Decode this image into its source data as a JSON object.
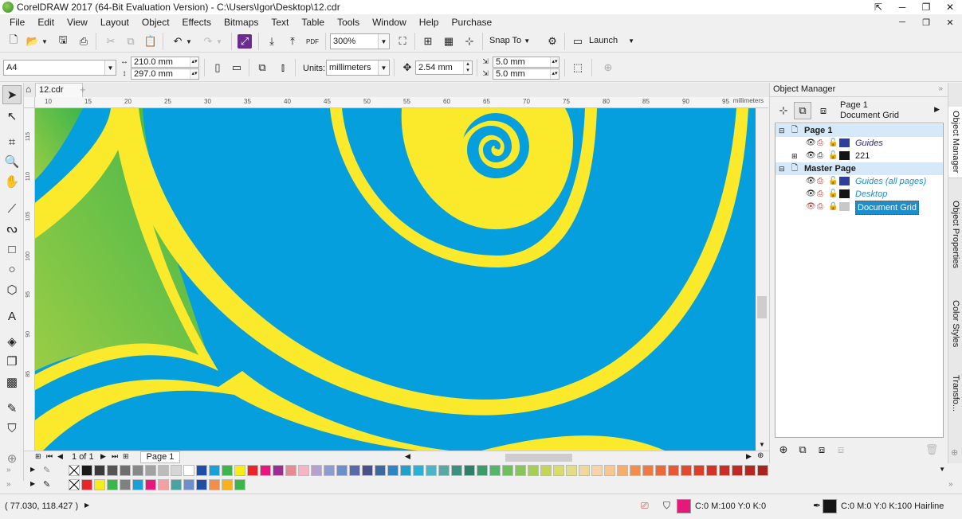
{
  "window": {
    "title": "CorelDRAW 2017 (64-Bit Evaluation Version) - C:\\Users\\Igor\\Desktop\\12.cdr"
  },
  "menu": [
    "File",
    "Edit",
    "View",
    "Layout",
    "Object",
    "Effects",
    "Bitmaps",
    "Text",
    "Table",
    "Tools",
    "Window",
    "Help",
    "Purchase"
  ],
  "standard_toolbar": {
    "zoom": "300%",
    "snap_label": "Snap To",
    "launch_label": "Launch",
    "pdf_label": "PDF"
  },
  "property_bar": {
    "page_size": "A4",
    "width": "210.0 mm",
    "height": "297.0 mm",
    "units_label": "Units:",
    "units_value": "millimeters",
    "nudge": "2.54 mm",
    "dup_x": "5.0 mm",
    "dup_y": "5.0 mm"
  },
  "doc_tab": {
    "name": "12.cdr",
    "add": "+"
  },
  "ruler": {
    "h_labels": [
      "10",
      "15",
      "20",
      "25",
      "30",
      "35",
      "40",
      "45",
      "50",
      "55",
      "60",
      "65",
      "70",
      "75",
      "80",
      "85",
      "90",
      "95"
    ],
    "h_unit": "millimeters",
    "v_labels": [
      "115",
      "110",
      "105",
      "100",
      "95",
      "90",
      "85"
    ]
  },
  "page_nav": {
    "current": "1",
    "of_label": "of",
    "total": "1",
    "page_tab": "Page 1"
  },
  "object_manager": {
    "title": "Object Manager",
    "header_page": "Page 1",
    "header_layer": "Document Grid",
    "rows": [
      {
        "label": "Page 1",
        "kind": "page"
      },
      {
        "label": "Guides",
        "kind": "layer",
        "color": "#2c3e9e"
      },
      {
        "label": "221",
        "kind": "layer",
        "color": "#141414"
      },
      {
        "label": "Master Page",
        "kind": "page"
      },
      {
        "label": "Guides (all pages)",
        "kind": "layer",
        "color": "#2c3e9e"
      },
      {
        "label": "Desktop",
        "kind": "layer",
        "color": "#141414"
      },
      {
        "label": "Document Grid",
        "kind": "layer",
        "color": "#c8c8c8"
      }
    ]
  },
  "docker_tabs": [
    "Object Manager",
    "Object Properties",
    "Color Styles",
    "Transfo..."
  ],
  "palette_main": [
    "#1a1a1a",
    "#3b3b3b",
    "#555555",
    "#6e6e6e",
    "#888888",
    "#a2a2a2",
    "#bcbcbc",
    "#d6d6d6",
    "#ffffff",
    "#1f4fa3",
    "#1aa0d6",
    "#3cb54a",
    "#f7ec1b",
    "#e9242a",
    "#e6197a",
    "#9a2f8e",
    "#e68a94",
    "#f4b6c3",
    "#b5a1cf",
    "#8f9bd0",
    "#6e8ec7",
    "#5a6aa8",
    "#4a4f8a",
    "#3d6a9e",
    "#2f84c1",
    "#22a0c8",
    "#2ab0d6",
    "#49b7c6",
    "#57a8a0",
    "#3e8f7e",
    "#2f7f6a",
    "#3d9a6a",
    "#56b36e",
    "#6fbf5e",
    "#8ac55a",
    "#a6cd55",
    "#c2d45b",
    "#d8dc6e",
    "#e3dd84",
    "#eed99a",
    "#f4d4a8",
    "#f6c78f",
    "#f4ae6c",
    "#f08f4c",
    "#ec7a41",
    "#e86a3a",
    "#e45a35",
    "#df4b30",
    "#d93f2c",
    "#d03428",
    "#c72f26",
    "#bd2b24",
    "#b22722",
    "#a62420"
  ],
  "palette_doc": [
    "#e9242a",
    "#f7ec1b",
    "#3cb54a",
    "#808080",
    "#1aa0d6",
    "#e6197a",
    "#f4a0a0",
    "#4aa3a0",
    "#6e8ec7",
    "#1f4fa3",
    "#f08f4c",
    "#f7b21b",
    "#3cb54a"
  ],
  "status": {
    "coords": "( 77.030, 118.427 )",
    "fill_text": "C:0 M:100 Y:0 K:0",
    "fill_color": "#e6197a",
    "outline_text": "C:0 M:0 Y:0 K:100  Hairline",
    "outline_color": "#141414"
  },
  "canvas_colors": {
    "background": "#069fdd",
    "spiral": "#fbe92c",
    "leaf_light": "#8dc63f",
    "leaf_dark": "#3db54a"
  }
}
